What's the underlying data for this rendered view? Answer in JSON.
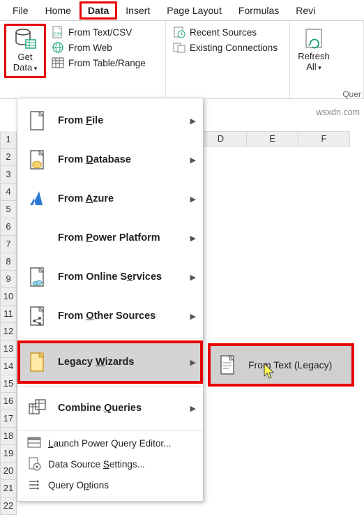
{
  "tabs": {
    "file": "File",
    "home": "Home",
    "data": "Data",
    "insert": "Insert",
    "pagelayout": "Page Layout",
    "formulas": "Formulas",
    "review": "Revi"
  },
  "ribbon": {
    "getdata": "Get\nData",
    "from_text_csv": "From Text/CSV",
    "from_web": "From Web",
    "from_table_range": "From Table/Range",
    "recent_sources": "Recent Sources",
    "existing_connections": "Existing Connections",
    "refresh_all": "Refresh\nAll",
    "quer": "Quer"
  },
  "columns": [
    "D",
    "E",
    "F"
  ],
  "rows": [
    "1",
    "2",
    "3",
    "4",
    "5",
    "6",
    "7",
    "8",
    "9",
    "10",
    "11",
    "12",
    "13",
    "14",
    "15",
    "16",
    "17",
    "18",
    "19",
    "20",
    "21",
    "22"
  ],
  "menu": {
    "from_file": {
      "pre": "From ",
      "u": "F",
      "post": "ile"
    },
    "from_database": {
      "pre": "From ",
      "u": "D",
      "post": "atabase"
    },
    "from_azure": {
      "pre": "From ",
      "u": "A",
      "post": "zure"
    },
    "from_power_platform": {
      "pre": "From ",
      "u": "P",
      "post": "ower Platform"
    },
    "from_online": {
      "pre": "From Online S",
      "u": "e",
      "post": "rvices"
    },
    "from_other": {
      "pre": "From ",
      "u": "O",
      "post": "ther Sources"
    },
    "legacy_wizards": {
      "pre": "Legacy ",
      "u": "W",
      "post": "izards"
    },
    "combine_queries": {
      "pre": "Combine ",
      "u": "Q",
      "post": "ueries"
    },
    "launch_pqe": {
      "pre": "",
      "u": "L",
      "post": "aunch Power Query Editor..."
    },
    "data_source_settings": {
      "pre": "Data Source ",
      "u": "S",
      "post": "ettings..."
    },
    "query_options": {
      "pre": "Query O",
      "u": "p",
      "post": "tions"
    }
  },
  "submenu": {
    "from_text_legacy": "From Text (Legacy)"
  },
  "watermark": "wsxdn.com"
}
